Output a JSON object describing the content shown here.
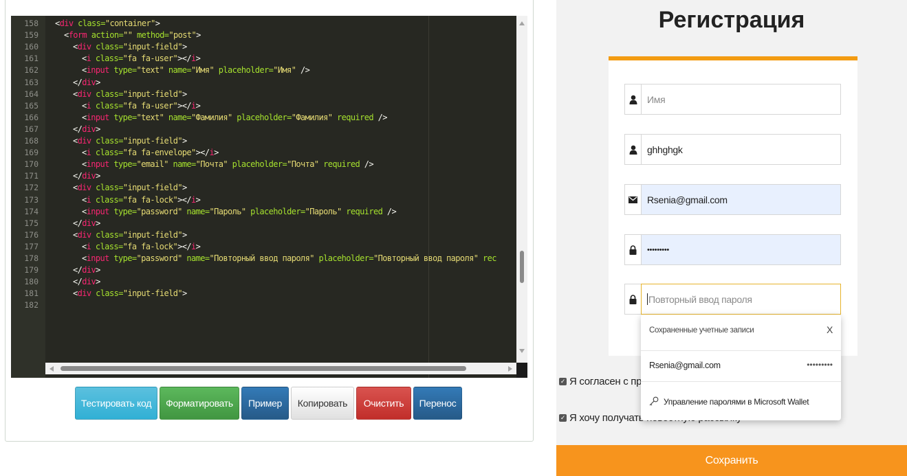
{
  "editor": {
    "lines": [
      {
        "num": "158",
        "indent": 0,
        "parts": [
          [
            "p",
            "<"
          ],
          [
            "t",
            "div"
          ],
          [
            "a",
            " class="
          ],
          [
            "s",
            "\"container\""
          ],
          [
            "p",
            ">"
          ]
        ]
      },
      {
        "num": "159",
        "indent": 1,
        "parts": [
          [
            "p",
            "<"
          ],
          [
            "t",
            "form"
          ],
          [
            "a",
            " action="
          ],
          [
            "s",
            "\"\""
          ],
          [
            "a",
            " method="
          ],
          [
            "s",
            "\"post\""
          ],
          [
            "p",
            ">"
          ]
        ]
      },
      {
        "num": "160",
        "indent": 2,
        "parts": [
          [
            "p",
            "<"
          ],
          [
            "t",
            "div"
          ],
          [
            "a",
            " class="
          ],
          [
            "s",
            "\"input-field\""
          ],
          [
            "p",
            ">"
          ]
        ]
      },
      {
        "num": "161",
        "indent": 3,
        "parts": [
          [
            "p",
            "<"
          ],
          [
            "t",
            "i"
          ],
          [
            "a",
            " class="
          ],
          [
            "s",
            "\"fa fa-user\""
          ],
          [
            "p",
            "></"
          ],
          [
            "t",
            "i"
          ],
          [
            "p",
            ">"
          ]
        ]
      },
      {
        "num": "162",
        "indent": 3,
        "parts": [
          [
            "p",
            "<"
          ],
          [
            "t",
            "input"
          ],
          [
            "a",
            " type="
          ],
          [
            "s",
            "\"text\""
          ],
          [
            "a",
            " name="
          ],
          [
            "s",
            "\"Имя\""
          ],
          [
            "a",
            " placeholder="
          ],
          [
            "s",
            "\"Имя\""
          ],
          [
            "p",
            " />"
          ]
        ]
      },
      {
        "num": "163",
        "indent": 2,
        "parts": [
          [
            "p",
            "</"
          ],
          [
            "t",
            "div"
          ],
          [
            "p",
            ">"
          ]
        ]
      },
      {
        "num": "164",
        "indent": 2,
        "parts": [
          [
            "p",
            "<"
          ],
          [
            "t",
            "div"
          ],
          [
            "a",
            " class="
          ],
          [
            "s",
            "\"input-field\""
          ],
          [
            "p",
            ">"
          ]
        ]
      },
      {
        "num": "165",
        "indent": 3,
        "parts": [
          [
            "p",
            "<"
          ],
          [
            "t",
            "i"
          ],
          [
            "a",
            " class="
          ],
          [
            "s",
            "\"fa fa-user\""
          ],
          [
            "p",
            "></"
          ],
          [
            "t",
            "i"
          ],
          [
            "p",
            ">"
          ]
        ]
      },
      {
        "num": "166",
        "indent": 3,
        "parts": [
          [
            "p",
            "<"
          ],
          [
            "t",
            "input"
          ],
          [
            "a",
            " type="
          ],
          [
            "s",
            "\"text\""
          ],
          [
            "a",
            " name="
          ],
          [
            "s",
            "\"Фамилия\""
          ],
          [
            "a",
            " placeholder="
          ],
          [
            "s",
            "\"Фамилия\""
          ],
          [
            "a",
            " required"
          ],
          [
            "p",
            " />"
          ]
        ]
      },
      {
        "num": "167",
        "indent": 2,
        "parts": [
          [
            "p",
            "</"
          ],
          [
            "t",
            "div"
          ],
          [
            "p",
            ">"
          ]
        ]
      },
      {
        "num": "168",
        "indent": 2,
        "parts": [
          [
            "p",
            "<"
          ],
          [
            "t",
            "div"
          ],
          [
            "a",
            " class="
          ],
          [
            "s",
            "\"input-field\""
          ],
          [
            "p",
            ">"
          ]
        ]
      },
      {
        "num": "169",
        "indent": 3,
        "parts": [
          [
            "p",
            "<"
          ],
          [
            "t",
            "i"
          ],
          [
            "a",
            " class="
          ],
          [
            "s",
            "\"fa fa-envelope\""
          ],
          [
            "p",
            "></"
          ],
          [
            "t",
            "i"
          ],
          [
            "p",
            ">"
          ]
        ]
      },
      {
        "num": "170",
        "indent": 3,
        "parts": [
          [
            "p",
            "<"
          ],
          [
            "t",
            "input"
          ],
          [
            "a",
            " type="
          ],
          [
            "s",
            "\"email\""
          ],
          [
            "a",
            " name="
          ],
          [
            "s",
            "\"Почта\""
          ],
          [
            "a",
            " placeholder="
          ],
          [
            "s",
            "\"Почта\""
          ],
          [
            "a",
            " required"
          ],
          [
            "p",
            " />"
          ]
        ]
      },
      {
        "num": "171",
        "indent": 2,
        "parts": [
          [
            "p",
            "</"
          ],
          [
            "t",
            "div"
          ],
          [
            "p",
            ">"
          ]
        ]
      },
      {
        "num": "172",
        "indent": 2,
        "parts": [
          [
            "p",
            "<"
          ],
          [
            "t",
            "div"
          ],
          [
            "a",
            " class="
          ],
          [
            "s",
            "\"input-field\""
          ],
          [
            "p",
            ">"
          ]
        ]
      },
      {
        "num": "173",
        "indent": 3,
        "parts": [
          [
            "p",
            "<"
          ],
          [
            "t",
            "i"
          ],
          [
            "a",
            " class="
          ],
          [
            "s",
            "\"fa fa-lock\""
          ],
          [
            "p",
            "></"
          ],
          [
            "t",
            "i"
          ],
          [
            "p",
            ">"
          ]
        ]
      },
      {
        "num": "174",
        "indent": 3,
        "parts": [
          [
            "p",
            "<"
          ],
          [
            "t",
            "input"
          ],
          [
            "a",
            " type="
          ],
          [
            "s",
            "\"password\""
          ],
          [
            "a",
            " name="
          ],
          [
            "s",
            "\"Пароль\""
          ],
          [
            "a",
            " placeholder="
          ],
          [
            "s",
            "\"Пароль\""
          ],
          [
            "a",
            " required"
          ],
          [
            "p",
            " />"
          ]
        ]
      },
      {
        "num": "175",
        "indent": 2,
        "parts": [
          [
            "p",
            "</"
          ],
          [
            "t",
            "div"
          ],
          [
            "p",
            ">"
          ]
        ]
      },
      {
        "num": "176",
        "indent": 2,
        "parts": [
          [
            "p",
            "<"
          ],
          [
            "t",
            "div"
          ],
          [
            "a",
            " class="
          ],
          [
            "s",
            "\"input-field\""
          ],
          [
            "p",
            ">"
          ]
        ]
      },
      {
        "num": "177",
        "indent": 3,
        "parts": [
          [
            "p",
            "<"
          ],
          [
            "t",
            "i"
          ],
          [
            "a",
            " class="
          ],
          [
            "s",
            "\"fa fa-lock\""
          ],
          [
            "p",
            "></"
          ],
          [
            "t",
            "i"
          ],
          [
            "p",
            ">"
          ]
        ]
      },
      {
        "num": "178",
        "indent": 3,
        "parts": [
          [
            "p",
            "<"
          ],
          [
            "t",
            "input"
          ],
          [
            "a",
            " type="
          ],
          [
            "s",
            "\"password\""
          ],
          [
            "a",
            " name="
          ],
          [
            "s",
            "\"Повторный ввод пароля\""
          ],
          [
            "a",
            " placeholder="
          ],
          [
            "s",
            "\"Повторный ввод пароля\""
          ],
          [
            "a",
            " rec"
          ]
        ]
      },
      {
        "num": "179",
        "indent": 2,
        "parts": [
          [
            "p",
            "</"
          ],
          [
            "t",
            "div"
          ],
          [
            "p",
            ">"
          ]
        ]
      },
      {
        "num": "180",
        "indent": 2,
        "parts": [
          [
            "p",
            "</"
          ],
          [
            "t",
            "div"
          ],
          [
            "p",
            ">"
          ]
        ]
      },
      {
        "num": "181",
        "indent": 2,
        "parts": [
          [
            "p",
            "<"
          ],
          [
            "t",
            "div"
          ],
          [
            "a",
            " class="
          ],
          [
            "s",
            "\"input-field\""
          ],
          [
            "p",
            ">"
          ]
        ]
      },
      {
        "num": "182",
        "indent": 0,
        "parts": []
      }
    ]
  },
  "toolbar": {
    "test_label": "Тестировать код",
    "format_label": "Форматировать",
    "example_label": "Пример",
    "copy_label": "Копировать",
    "clear_label": "Очистить",
    "wrap_label": "Перенос"
  },
  "registration": {
    "title": "Регистрация",
    "fields": {
      "first_name_placeholder": "Имя",
      "last_name_value": "ghhghgk",
      "email_value": "Rsenia@gmail.com",
      "password_value": "•••••••••",
      "repeat_password_placeholder": "Повторный ввод пароля"
    },
    "checkbox_terms": "Я согласен с пр",
    "checkbox_newsletter": "Я хочу получать новостную рассылку",
    "save_label": "Сохранить"
  },
  "popup": {
    "heading": "Сохраненные учетные записи",
    "close": "X",
    "account": "Rsenia@gmail.com",
    "account_dots": "•••••••••",
    "manage": "Управление паролями в Microsoft Wallet"
  },
  "colors": {
    "editor_bg": "#272822",
    "accent": "#f39c12",
    "save": "#f7941d"
  },
  "icons": {
    "user": "user-icon",
    "envelope": "envelope-icon",
    "lock": "lock-icon",
    "key": "key-icon"
  }
}
